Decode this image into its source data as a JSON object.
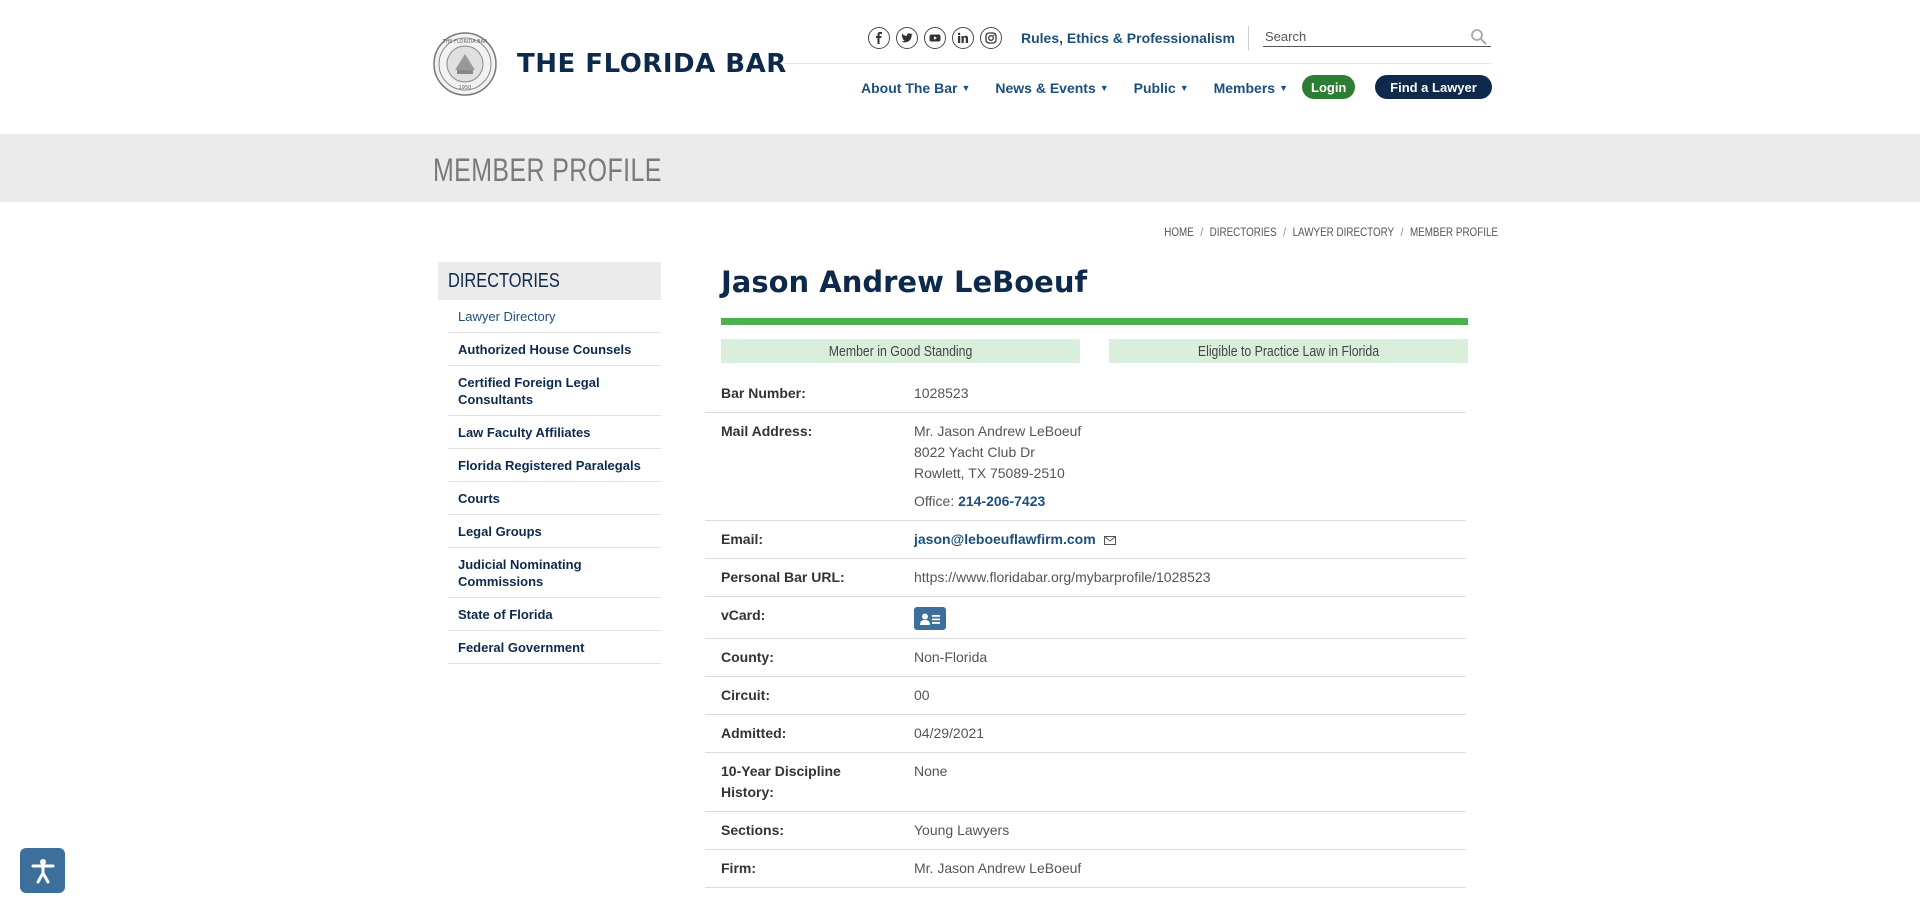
{
  "header": {
    "brand": "THE FLORIDA BAR",
    "seal_text": "THE FLORIDA BAR 1950",
    "social_icons": [
      "facebook-icon",
      "twitter-icon",
      "youtube-icon",
      "linkedin-icon",
      "instagram-icon"
    ],
    "rules_link": "Rules, Ethics & Professionalism",
    "search_placeholder": "Search",
    "nav": [
      "About The Bar",
      "News & Events",
      "Public",
      "Members"
    ],
    "login_label": "Login",
    "find_lawyer_label": "Find a Lawyer",
    "colors": {
      "navy": "#0d2a4d",
      "link": "#1d4f7d",
      "green": "#2e7d34"
    }
  },
  "banner": {
    "title": "MEMBER PROFILE"
  },
  "breadcrumb": [
    "HOME",
    "DIRECTORIES",
    "LAWYER DIRECTORY",
    "MEMBER PROFILE"
  ],
  "sidebar": {
    "heading": "DIRECTORIES",
    "items": [
      "Lawyer Directory",
      "Authorized House Counsels",
      "Certified Foreign Legal Consultants",
      "Law Faculty Affiliates",
      "Florida Registered Paralegals",
      "Courts",
      "Legal Groups",
      "Judicial Nominating Commissions",
      "State of Florida",
      "Federal Government"
    ],
    "active_index": 0
  },
  "profile": {
    "name": "Jason Andrew LeBoeuf",
    "status_1": "Member in Good Standing",
    "status_2": "Eligible to Practice Law in Florida",
    "bar_number_label": "Bar Number:",
    "bar_number": "1028523",
    "mail_label": "Mail Address:",
    "mail_line1": "Mr. Jason Andrew LeBoeuf",
    "mail_line2": "8022 Yacht Club Dr",
    "mail_line3": "Rowlett, TX 75089-2510",
    "office_label": "Office:",
    "office_phone": "214-206-7423",
    "email_label": "Email:",
    "email": "jason@leboeuflawfirm.com",
    "url_label": "Personal Bar URL:",
    "url": "https://www.floridabar.org/mybarprofile/1028523",
    "vcard_label": "vCard:",
    "county_label": "County:",
    "county": "Non-Florida",
    "circuit_label": "Circuit:",
    "circuit": "00",
    "admitted_label": "Admitted:",
    "admitted": "04/29/2021",
    "discipline_label": "10-Year Discipline History:",
    "discipline": "None",
    "sections_label": "Sections:",
    "sections": "Young Lawyers",
    "firm_label": "Firm:",
    "firm": "Mr. Jason Andrew LeBoeuf"
  }
}
